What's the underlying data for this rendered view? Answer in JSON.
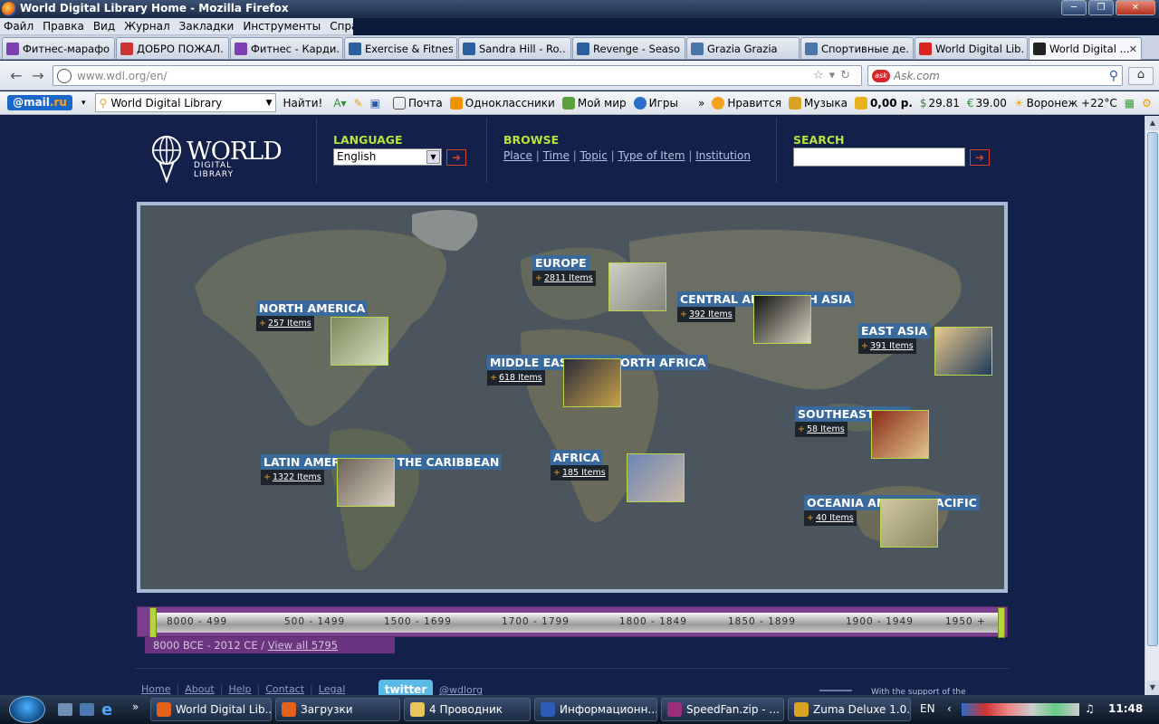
{
  "window": {
    "title": "World Digital Library Home - Mozilla Firefox"
  },
  "menu": [
    "Файл",
    "Правка",
    "Вид",
    "Журнал",
    "Закладки",
    "Инструменты",
    "Справка"
  ],
  "tabs": [
    {
      "label": "Фитнес-марафо...",
      "icon_color": "#7a3fb0"
    },
    {
      "label": "ДОБРО ПОЖАЛ...",
      "icon_color": "#c33"
    },
    {
      "label": "Фитнес - Карди...",
      "icon_color": "#7a3fb0"
    },
    {
      "label": "Exercise & Fitness",
      "icon_color": "#2b5f9e"
    },
    {
      "label": "Sandra Hill - Ro...",
      "icon_color": "#2b5f9e"
    },
    {
      "label": "Revenge - Seaso...",
      "icon_color": "#2b5f9e"
    },
    {
      "label": "Grazia Grazia",
      "icon_color": "#4a76a8"
    },
    {
      "label": "Спортивные де...",
      "icon_color": "#4a76a8"
    },
    {
      "label": "World Digital Lib...",
      "icon_color": "#d22"
    },
    {
      "label": "World Digital ...",
      "icon_color": "#222",
      "active": true
    }
  ],
  "nav": {
    "url": "www.wdl.org/en/",
    "search_placeholder": "Ask.com"
  },
  "mailbar": {
    "logo_prefix": "@",
    "logo_mail": "mail",
    "logo_ru": ".ru",
    "search_value": "World Digital Library",
    "find_label": "Найти!",
    "items": [
      "Почта",
      "Одноклассники",
      "Мой мир",
      "Игры",
      "Нравится",
      "Музыка"
    ],
    "money": "0,00 р.",
    "usd": "29.81",
    "eur": "39.00",
    "weather": "Воронеж +22°C"
  },
  "header": {
    "logo_world": "WORLD",
    "logo_dl": "DIGITAL LIBRARY",
    "language_title": "LANGUAGE",
    "language_value": "English",
    "browse_title": "BROWSE",
    "browse_links": [
      "Place",
      "Time",
      "Topic",
      "Type of Item",
      "Institution"
    ],
    "search_title": "SEARCH"
  },
  "regions": [
    {
      "name": "NORTH AMERICA",
      "count": "257 Items"
    },
    {
      "name": "EUROPE",
      "count": "2811 Items"
    },
    {
      "name": "CENTRAL AND SOUTH ASIA",
      "count": "392 Items"
    },
    {
      "name": "EAST ASIA",
      "count": "391 Items"
    },
    {
      "name": "MIDDLE EAST AND NORTH AFRICA",
      "count": "618 Items"
    },
    {
      "name": "SOUTHEAST ASIA",
      "count": "58 Items"
    },
    {
      "name": "LATIN AMERICA AND THE CARIBBEAN",
      "count": "1322 Items"
    },
    {
      "name": "AFRICA",
      "count": "185 Items"
    },
    {
      "name": "OCEANIA AND THE PACIFIC",
      "count": "40 Items"
    }
  ],
  "timeline": {
    "labels": [
      "8000 - 499",
      "500 - 1499",
      "1500 - 1699",
      "1700 - 1799",
      "1800 - 1849",
      "1850 - 1899",
      "1900 - 1949",
      "1950 +"
    ],
    "range_text": "8000 BCE - 2012 CE /",
    "view_all": "View all 5795"
  },
  "footer": {
    "links": [
      "Home",
      "About",
      "Help",
      "Contact",
      "Legal"
    ],
    "twitter": "twitter",
    "twitter_handle": "@wdlorg",
    "support": "With the support of the"
  },
  "taskbar": {
    "items": [
      {
        "label": "World Digital Lib...",
        "icon_color": "#e3621b"
      },
      {
        "label": "Загрузки",
        "icon_color": "#e3621b"
      },
      {
        "label": "4 Проводник",
        "icon_color": "#e8c55a"
      },
      {
        "label": "Информационн...",
        "icon_color": "#2b5cb8"
      },
      {
        "label": "SpeedFan.zip - ...",
        "icon_color": "#9b2d7a"
      },
      {
        "label": "Zuma Deluxe 1.0...",
        "icon_color": "#d9a321"
      }
    ],
    "lang": "EN",
    "clock": "11:48"
  }
}
